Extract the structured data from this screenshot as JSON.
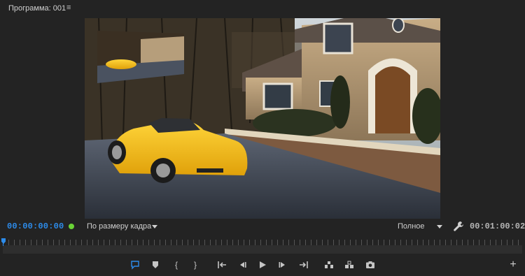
{
  "panel": {
    "title": "Программа: 001"
  },
  "playback": {
    "current_timecode": "00:00:00:00",
    "fit_option": "По размеру кадра",
    "resolution": "Полное",
    "duration_timecode": "00:01:00:02"
  },
  "colors": {
    "accent": "#2d8ceb",
    "status": "#6ad336",
    "background": "#232323"
  },
  "transport_icons": [
    "add-marker-icon",
    "marker-icon",
    "mark-in-icon",
    "mark-out-icon",
    "go-to-in-icon",
    "step-back-icon",
    "play-icon",
    "step-forward-icon",
    "go-to-out-icon",
    "lift-icon",
    "extract-icon",
    "export-frame-icon"
  ]
}
